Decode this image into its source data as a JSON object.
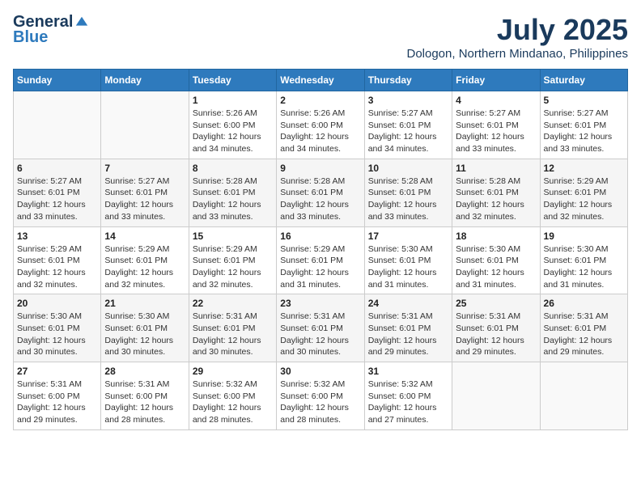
{
  "header": {
    "logo": {
      "general": "General",
      "blue": "Blue"
    },
    "title": "July 2025",
    "location": "Dologon, Northern Mindanao, Philippines"
  },
  "weekdays": [
    "Sunday",
    "Monday",
    "Tuesday",
    "Wednesday",
    "Thursday",
    "Friday",
    "Saturday"
  ],
  "weeks": [
    [
      {
        "day": "",
        "sunrise": "",
        "sunset": "",
        "daylight": ""
      },
      {
        "day": "",
        "sunrise": "",
        "sunset": "",
        "daylight": ""
      },
      {
        "day": "1",
        "sunrise": "Sunrise: 5:26 AM",
        "sunset": "Sunset: 6:00 PM",
        "daylight": "Daylight: 12 hours and 34 minutes."
      },
      {
        "day": "2",
        "sunrise": "Sunrise: 5:26 AM",
        "sunset": "Sunset: 6:00 PM",
        "daylight": "Daylight: 12 hours and 34 minutes."
      },
      {
        "day": "3",
        "sunrise": "Sunrise: 5:27 AM",
        "sunset": "Sunset: 6:01 PM",
        "daylight": "Daylight: 12 hours and 34 minutes."
      },
      {
        "day": "4",
        "sunrise": "Sunrise: 5:27 AM",
        "sunset": "Sunset: 6:01 PM",
        "daylight": "Daylight: 12 hours and 33 minutes."
      },
      {
        "day": "5",
        "sunrise": "Sunrise: 5:27 AM",
        "sunset": "Sunset: 6:01 PM",
        "daylight": "Daylight: 12 hours and 33 minutes."
      }
    ],
    [
      {
        "day": "6",
        "sunrise": "Sunrise: 5:27 AM",
        "sunset": "Sunset: 6:01 PM",
        "daylight": "Daylight: 12 hours and 33 minutes."
      },
      {
        "day": "7",
        "sunrise": "Sunrise: 5:27 AM",
        "sunset": "Sunset: 6:01 PM",
        "daylight": "Daylight: 12 hours and 33 minutes."
      },
      {
        "day": "8",
        "sunrise": "Sunrise: 5:28 AM",
        "sunset": "Sunset: 6:01 PM",
        "daylight": "Daylight: 12 hours and 33 minutes."
      },
      {
        "day": "9",
        "sunrise": "Sunrise: 5:28 AM",
        "sunset": "Sunset: 6:01 PM",
        "daylight": "Daylight: 12 hours and 33 minutes."
      },
      {
        "day": "10",
        "sunrise": "Sunrise: 5:28 AM",
        "sunset": "Sunset: 6:01 PM",
        "daylight": "Daylight: 12 hours and 33 minutes."
      },
      {
        "day": "11",
        "sunrise": "Sunrise: 5:28 AM",
        "sunset": "Sunset: 6:01 PM",
        "daylight": "Daylight: 12 hours and 32 minutes."
      },
      {
        "day": "12",
        "sunrise": "Sunrise: 5:29 AM",
        "sunset": "Sunset: 6:01 PM",
        "daylight": "Daylight: 12 hours and 32 minutes."
      }
    ],
    [
      {
        "day": "13",
        "sunrise": "Sunrise: 5:29 AM",
        "sunset": "Sunset: 6:01 PM",
        "daylight": "Daylight: 12 hours and 32 minutes."
      },
      {
        "day": "14",
        "sunrise": "Sunrise: 5:29 AM",
        "sunset": "Sunset: 6:01 PM",
        "daylight": "Daylight: 12 hours and 32 minutes."
      },
      {
        "day": "15",
        "sunrise": "Sunrise: 5:29 AM",
        "sunset": "Sunset: 6:01 PM",
        "daylight": "Daylight: 12 hours and 32 minutes."
      },
      {
        "day": "16",
        "sunrise": "Sunrise: 5:29 AM",
        "sunset": "Sunset: 6:01 PM",
        "daylight": "Daylight: 12 hours and 31 minutes."
      },
      {
        "day": "17",
        "sunrise": "Sunrise: 5:30 AM",
        "sunset": "Sunset: 6:01 PM",
        "daylight": "Daylight: 12 hours and 31 minutes."
      },
      {
        "day": "18",
        "sunrise": "Sunrise: 5:30 AM",
        "sunset": "Sunset: 6:01 PM",
        "daylight": "Daylight: 12 hours and 31 minutes."
      },
      {
        "day": "19",
        "sunrise": "Sunrise: 5:30 AM",
        "sunset": "Sunset: 6:01 PM",
        "daylight": "Daylight: 12 hours and 31 minutes."
      }
    ],
    [
      {
        "day": "20",
        "sunrise": "Sunrise: 5:30 AM",
        "sunset": "Sunset: 6:01 PM",
        "daylight": "Daylight: 12 hours and 30 minutes."
      },
      {
        "day": "21",
        "sunrise": "Sunrise: 5:30 AM",
        "sunset": "Sunset: 6:01 PM",
        "daylight": "Daylight: 12 hours and 30 minutes."
      },
      {
        "day": "22",
        "sunrise": "Sunrise: 5:31 AM",
        "sunset": "Sunset: 6:01 PM",
        "daylight": "Daylight: 12 hours and 30 minutes."
      },
      {
        "day": "23",
        "sunrise": "Sunrise: 5:31 AM",
        "sunset": "Sunset: 6:01 PM",
        "daylight": "Daylight: 12 hours and 30 minutes."
      },
      {
        "day": "24",
        "sunrise": "Sunrise: 5:31 AM",
        "sunset": "Sunset: 6:01 PM",
        "daylight": "Daylight: 12 hours and 29 minutes."
      },
      {
        "day": "25",
        "sunrise": "Sunrise: 5:31 AM",
        "sunset": "Sunset: 6:01 PM",
        "daylight": "Daylight: 12 hours and 29 minutes."
      },
      {
        "day": "26",
        "sunrise": "Sunrise: 5:31 AM",
        "sunset": "Sunset: 6:01 PM",
        "daylight": "Daylight: 12 hours and 29 minutes."
      }
    ],
    [
      {
        "day": "27",
        "sunrise": "Sunrise: 5:31 AM",
        "sunset": "Sunset: 6:00 PM",
        "daylight": "Daylight: 12 hours and 29 minutes."
      },
      {
        "day": "28",
        "sunrise": "Sunrise: 5:31 AM",
        "sunset": "Sunset: 6:00 PM",
        "daylight": "Daylight: 12 hours and 28 minutes."
      },
      {
        "day": "29",
        "sunrise": "Sunrise: 5:32 AM",
        "sunset": "Sunset: 6:00 PM",
        "daylight": "Daylight: 12 hours and 28 minutes."
      },
      {
        "day": "30",
        "sunrise": "Sunrise: 5:32 AM",
        "sunset": "Sunset: 6:00 PM",
        "daylight": "Daylight: 12 hours and 28 minutes."
      },
      {
        "day": "31",
        "sunrise": "Sunrise: 5:32 AM",
        "sunset": "Sunset: 6:00 PM",
        "daylight": "Daylight: 12 hours and 27 minutes."
      },
      {
        "day": "",
        "sunrise": "",
        "sunset": "",
        "daylight": ""
      },
      {
        "day": "",
        "sunrise": "",
        "sunset": "",
        "daylight": ""
      }
    ]
  ]
}
